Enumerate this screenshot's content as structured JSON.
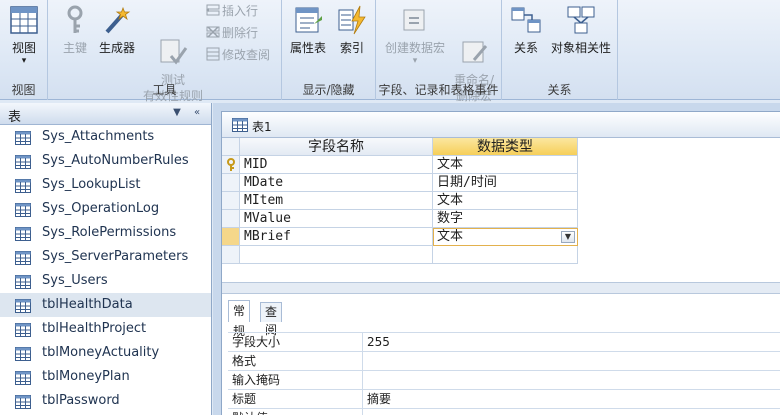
{
  "ribbon": {
    "groups": [
      {
        "label": "视图",
        "buttons": [
          {
            "label": "视图"
          }
        ]
      },
      {
        "label": "工具",
        "buttons": [
          {
            "label": "主键"
          },
          {
            "label": "生成器"
          },
          {
            "label": "测试\n有效性规则"
          }
        ],
        "small": [
          "插入行",
          "删除行",
          "修改查阅"
        ]
      },
      {
        "label": "显示/隐藏",
        "buttons": [
          {
            "label": "属性表"
          },
          {
            "label": "索引"
          }
        ]
      },
      {
        "label": "字段、记录和表格事件",
        "buttons": [
          {
            "label": "创建数据宏"
          },
          {
            "label": "重命名/\n删除宏"
          }
        ]
      },
      {
        "label": "关系",
        "buttons": [
          {
            "label": "关系"
          },
          {
            "label": "对象相关性"
          }
        ]
      }
    ]
  },
  "nav": {
    "title": "表",
    "items": [
      "Sys_Attachments",
      "Sys_AutoNumberRules",
      "Sys_LookupList",
      "Sys_OperationLog",
      "Sys_RolePermissions",
      "Sys_ServerParameters",
      "Sys_Users",
      "tblHealthData",
      "tblHealthProject",
      "tblMoneyActuality",
      "tblMoneyPlan",
      "tblPassword"
    ],
    "selected": "tblHealthData"
  },
  "document": {
    "tab_title": "表1",
    "columns": [
      "字段名称",
      "数据类型"
    ],
    "rows": [
      {
        "name": "MID",
        "type": "文本",
        "key": true
      },
      {
        "name": "MDate",
        "type": "日期/时间"
      },
      {
        "name": "MItem",
        "type": "文本"
      },
      {
        "name": "MValue",
        "type": "数字"
      },
      {
        "name": "MBrief",
        "type": "文本"
      }
    ],
    "current_row": 4
  },
  "properties": {
    "tabs": [
      "常规",
      "查阅"
    ],
    "active_tab": "常规",
    "rows": [
      {
        "name": "字段大小",
        "value": "255"
      },
      {
        "name": "格式",
        "value": ""
      },
      {
        "name": "输入掩码",
        "value": ""
      },
      {
        "name": "标题",
        "value": "摘要"
      },
      {
        "name": "默认值",
        "value": ""
      }
    ]
  }
}
